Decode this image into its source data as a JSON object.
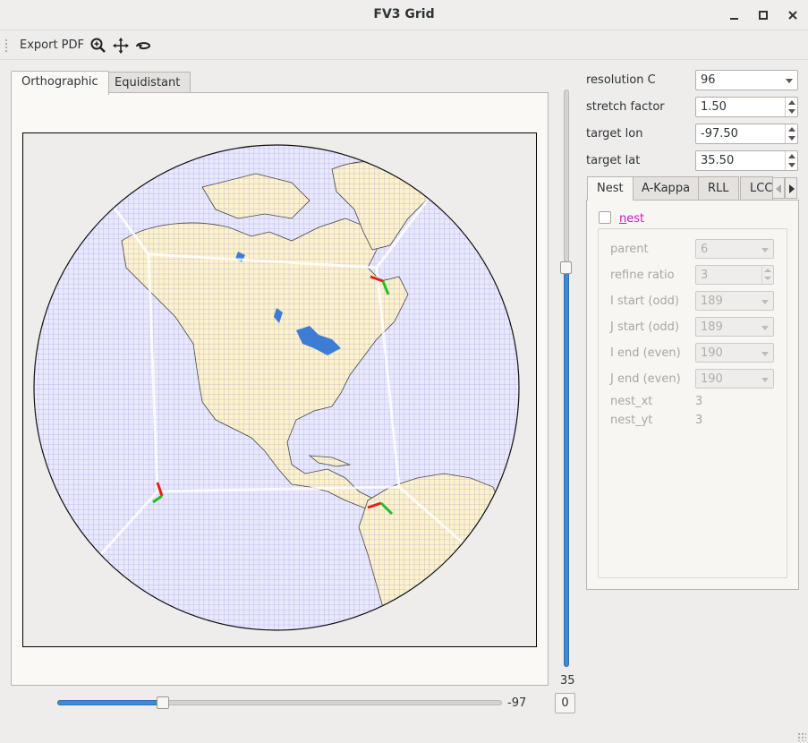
{
  "window": {
    "title": "FV3 Grid"
  },
  "toolbar": {
    "export_label": "Export PDF"
  },
  "tabs": {
    "orthographic": "Orthographic",
    "equidistant": "Equidistant"
  },
  "sliders": {
    "vertical_value": "35",
    "horizontal_value": "-97",
    "reset_label": "0"
  },
  "form": {
    "resolution_label": "resolution C",
    "resolution_value": "96",
    "stretch_label": "stretch factor",
    "stretch_value": "1.50",
    "lon_label": "target lon",
    "lon_value": "-97.50",
    "lat_label": "target lat",
    "lat_value": "35.50"
  },
  "right_tabs": {
    "nest": "Nest",
    "akappa": "A-Kappa",
    "rll": "RLL",
    "lcc": "LCC"
  },
  "nest": {
    "checkbox_label_first": "n",
    "checkbox_label_rest": "est",
    "parent_label": "parent",
    "parent_value": "6",
    "refine_label": "refine ratio",
    "refine_value": "3",
    "istart_label": "I start (odd)",
    "istart_value": "189",
    "jstart_label": "J start (odd)",
    "jstart_value": "189",
    "iend_label": "I end (even)",
    "iend_value": "190",
    "jend_label": "J end (even)",
    "jend_value": "190",
    "xt_label": "nest_xt",
    "xt_value": "3",
    "yt_label": "nest_yt",
    "yt_value": "3"
  },
  "colors": {
    "accent": "#3b8bd7",
    "land": "#fdf2c9",
    "grid": "#5a5ae6",
    "link": "#c020c0"
  }
}
